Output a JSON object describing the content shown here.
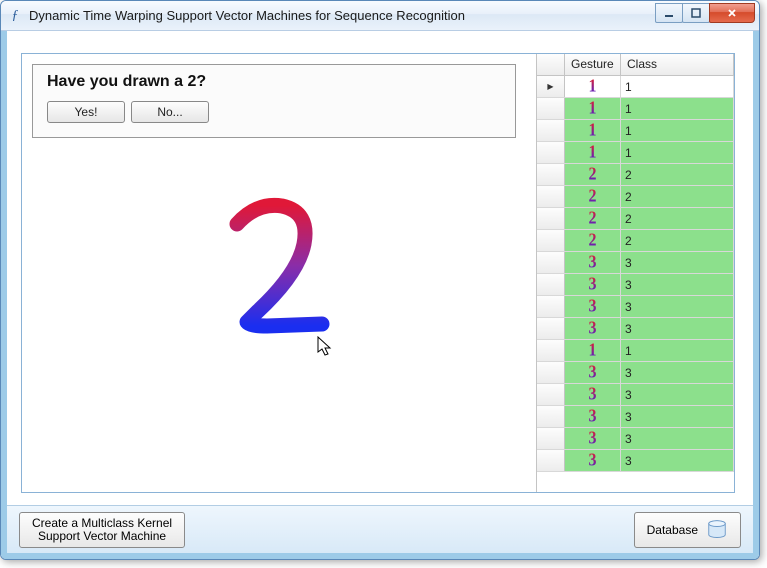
{
  "window": {
    "title": "Dynamic Time Warping Support Vector Machines for Sequence Recognition"
  },
  "prompt": {
    "question": "Have you drawn a 2?",
    "yes_label": "Yes!",
    "no_label": "No..."
  },
  "drawn_glyph": "2",
  "grid": {
    "columns": {
      "gesture": "Gesture",
      "class": "Class"
    },
    "rows": [
      {
        "gesture": "1",
        "class": "1",
        "selected": true
      },
      {
        "gesture": "1",
        "class": "1"
      },
      {
        "gesture": "1",
        "class": "1"
      },
      {
        "gesture": "1",
        "class": "1"
      },
      {
        "gesture": "2",
        "class": "2"
      },
      {
        "gesture": "2",
        "class": "2"
      },
      {
        "gesture": "2",
        "class": "2"
      },
      {
        "gesture": "2",
        "class": "2"
      },
      {
        "gesture": "3",
        "class": "3"
      },
      {
        "gesture": "3",
        "class": "3"
      },
      {
        "gesture": "3",
        "class": "3"
      },
      {
        "gesture": "3",
        "class": "3"
      },
      {
        "gesture": "1",
        "class": "1"
      },
      {
        "gesture": "3",
        "class": "3"
      },
      {
        "gesture": "3",
        "class": "3"
      },
      {
        "gesture": "3",
        "class": "3"
      },
      {
        "gesture": "3",
        "class": "3"
      },
      {
        "gesture": "3",
        "class": "3"
      }
    ]
  },
  "bottom": {
    "create_line1": "Create a Multiclass Kernel",
    "create_line2": "Support Vector Machine",
    "database_label": "Database"
  }
}
